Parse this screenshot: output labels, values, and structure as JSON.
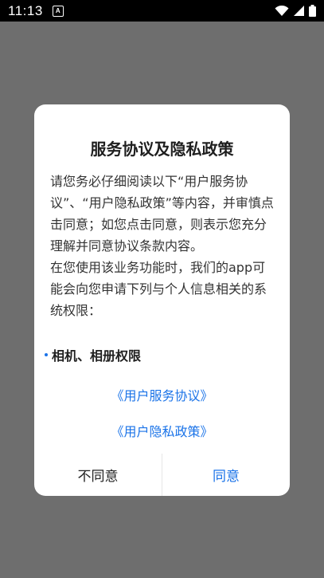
{
  "status_bar": {
    "time": "11:13",
    "notification_icon_letter": "A",
    "icons": [
      "wifi-icon",
      "signal-icon",
      "battery-icon"
    ]
  },
  "dialog": {
    "title": "服务协议及隐私政策",
    "paragraph1": "请您务必仔细阅读以下“用户服务协议”、“用户隐私政策”等内容，并审慎点击同意；如您点击同意，则表示您充分理解并同意协议条款内容。",
    "paragraph2": "在您使用该业务功能时，我们的app可能会向您申请下列与个人信息相关的系统权限：",
    "permission_item": "相机、相册权限",
    "link_service": "《用户服务协议》",
    "link_privacy": "《用户隐私政策》",
    "disagree_label": "不同意",
    "agree_label": "同意"
  },
  "colors": {
    "accent": "#1a73e8",
    "overlay": "#6e6e6e"
  }
}
